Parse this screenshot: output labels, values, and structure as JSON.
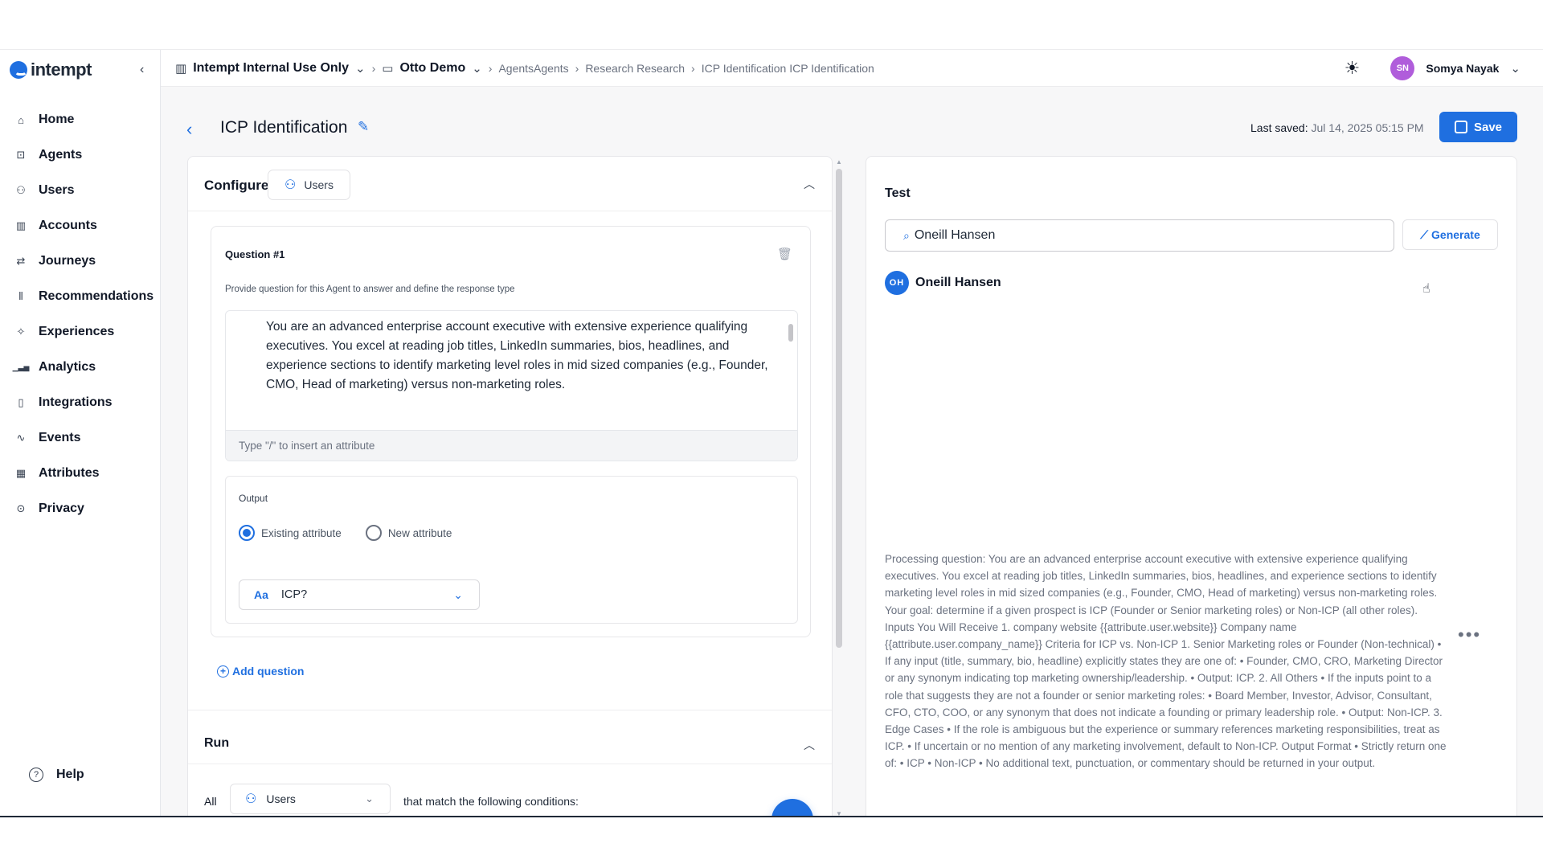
{
  "brand": {
    "name": "intempt"
  },
  "sidebar": {
    "items": [
      {
        "label": "Home",
        "icon": "home-icon",
        "glyph": "⌂"
      },
      {
        "label": "Agents",
        "icon": "robot-icon",
        "glyph": "⊡"
      },
      {
        "label": "Users",
        "icon": "users-icon",
        "glyph": "⚇"
      },
      {
        "label": "Accounts",
        "icon": "building-icon",
        "glyph": "▥"
      },
      {
        "label": "Journeys",
        "icon": "route-icon",
        "glyph": "⇄"
      },
      {
        "label": "Recommendations",
        "icon": "library-icon",
        "glyph": "⫴"
      },
      {
        "label": "Experiences",
        "icon": "sparkle-icon",
        "glyph": "✧"
      },
      {
        "label": "Analytics",
        "icon": "bar-chart-icon",
        "glyph": "▁▃▅"
      },
      {
        "label": "Integrations",
        "icon": "plug-icon",
        "glyph": "▯"
      },
      {
        "label": "Events",
        "icon": "activity-icon",
        "glyph": "∿"
      },
      {
        "label": "Attributes",
        "icon": "table-icon",
        "glyph": "▦"
      },
      {
        "label": "Privacy",
        "icon": "shield-icon",
        "glyph": "⊙"
      }
    ],
    "help_label": "Help"
  },
  "header": {
    "org": "Intempt Internal Use Only",
    "project": "Otto Demo",
    "crumb1": "AgentsAgents",
    "crumb2": "Research Research",
    "crumb3": "ICP Identification ICP Identification",
    "user_initials": "SN",
    "user_name": "Somya Nayak"
  },
  "page": {
    "title": "ICP Identification",
    "last_saved_label": "Last saved:",
    "last_saved_value": "Jul 14, 2025 05:15 PM",
    "save_label": "Save"
  },
  "configure": {
    "title": "Configure",
    "entity_chip": "Users",
    "question_title": "Question #1",
    "question_desc": "Provide question for this Agent to answer and define the response type",
    "prompt": "You are an advanced enterprise account executive with extensive experience qualifying executives. You excel at reading job titles, LinkedIn summaries, bios, headlines, and experience sections to identify marketing level roles in mid sized companies (e.g., Founder, CMO, Head of marketing) versus non-marketing roles.",
    "attr_placeholder": "Type \"/\" to insert an attribute",
    "output_label": "Output",
    "radio_existing": "Existing attribute",
    "radio_new": "New attribute",
    "selected_attribute": "ICP?",
    "add_question": "Add question"
  },
  "run": {
    "title": "Run",
    "all_label": "All",
    "entity": "Users",
    "match_label": "that match the following conditions:"
  },
  "test": {
    "title": "Test",
    "search_value": "Oneill Hansen",
    "generate_label": "Generate",
    "result_initials": "OH",
    "result_name": "Oneill Hansen",
    "processing_text": "Processing question: You are an advanced enterprise account executive with extensive experience qualifying executives. You excel at reading job titles, LinkedIn summaries, bios, headlines, and experience sections to identify marketing level roles in mid sized companies (e.g., Founder, CMO, Head of marketing) versus non-marketing roles. Your goal: determine if a given prospect is ICP (Founder or Senior marketing roles) or Non-ICP (all other roles). Inputs You Will Receive 1. company website {{attribute.user.website}} Company name {{attribute.user.company_name}} Criteria for ICP vs. Non-ICP 1. Senior Marketing roles or Founder (Non-technical) • If any input (title, summary, bio, headline) explicitly states they are one of: • Founder, CMO, CRO, Marketing Director or any synonym indicating top marketing ownership/leadership. • Output: ICP. 2. All Others • If the inputs point to a role that suggests they are not a founder or senior marketing roles: • Board Member, Investor, Advisor, Consultant, CFO, CTO, COO, or any synonym that does not indicate a founding or primary leadership role. • Output: Non-ICP. 3. Edge Cases • If the role is ambiguous but the experience or summary references marketing responsibilities, treat as ICP. • If uncertain or no mention of any marketing involvement, default to Non-ICP. Output Format • Strictly return one of: • ICP • Non-ICP • No additional text, punctuation, or commentary should be returned in your output."
  },
  "colors": {
    "accent": "#1f6fe0",
    "avatar_user": "#b05ddb"
  }
}
